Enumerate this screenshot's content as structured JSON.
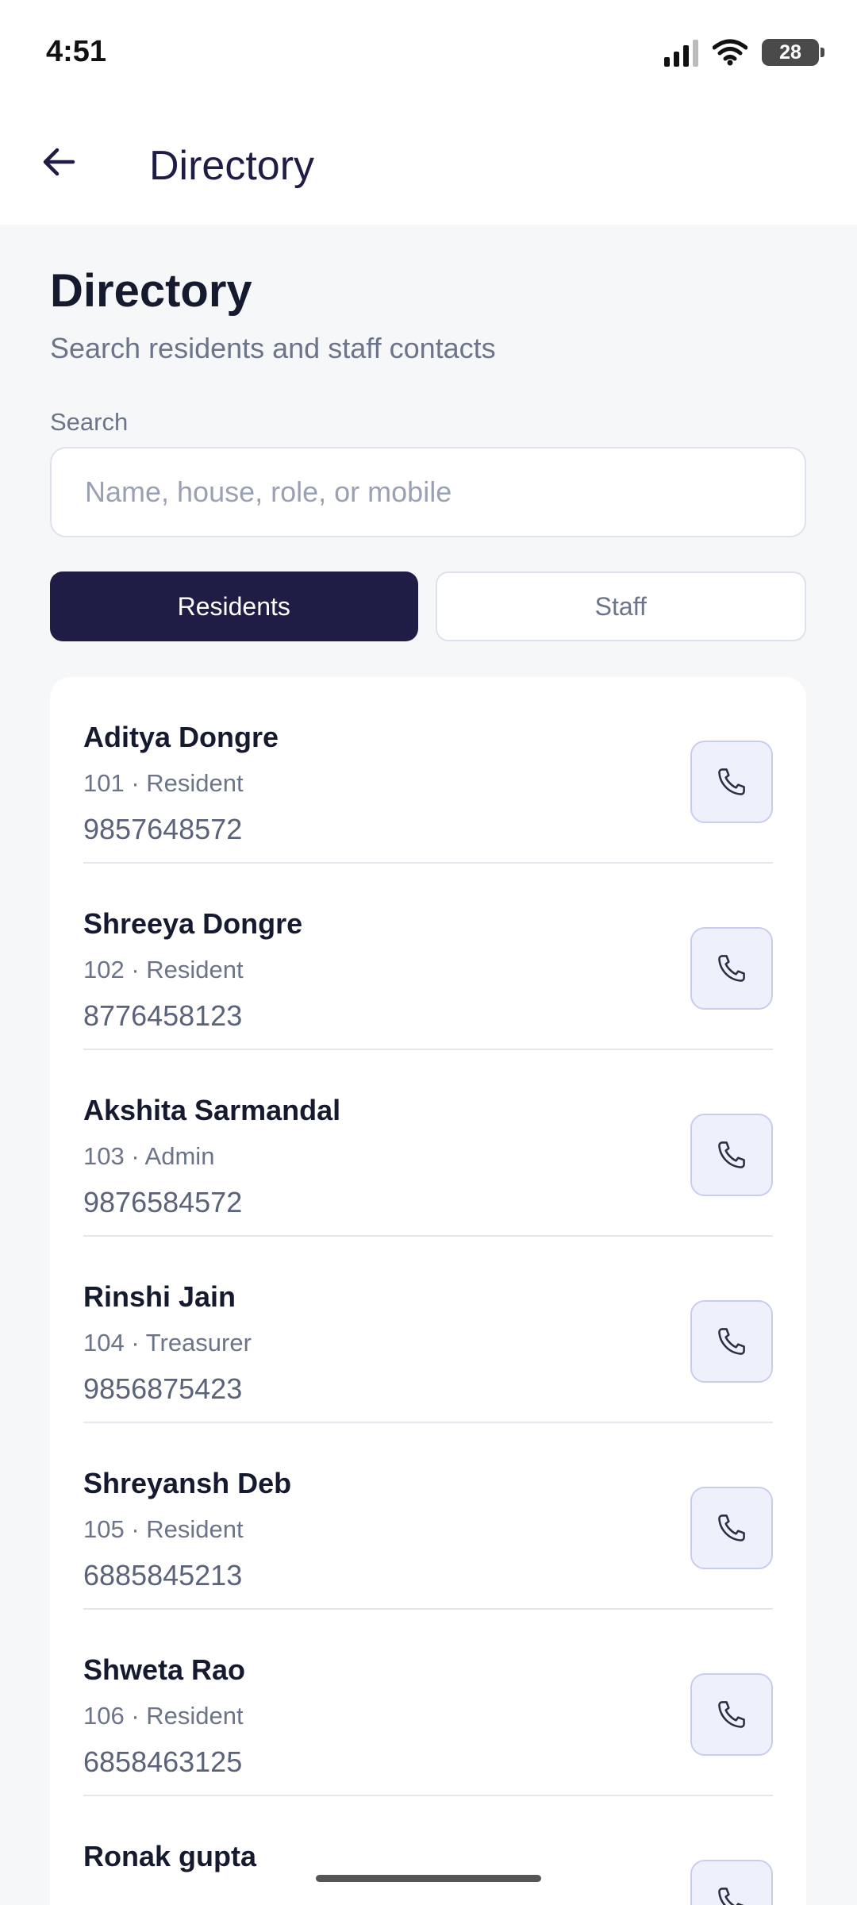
{
  "status_bar": {
    "time": "4:51",
    "battery": "28"
  },
  "app_bar": {
    "title": "Directory"
  },
  "header": {
    "title": "Directory",
    "subtitle": "Search residents and staff contacts"
  },
  "search": {
    "label": "Search",
    "placeholder": "Name, house, role, or mobile",
    "value": ""
  },
  "tabs": [
    {
      "label": "Residents",
      "active": true
    },
    {
      "label": "Staff",
      "active": false
    }
  ],
  "contacts": [
    {
      "name": "Aditya Dongre",
      "meta": "101 · Resident",
      "phone": "9857648572"
    },
    {
      "name": "Shreeya Dongre",
      "meta": "102 · Resident",
      "phone": "8776458123"
    },
    {
      "name": "Akshita Sarmandal",
      "meta": "103 · Admin",
      "phone": "9876584572"
    },
    {
      "name": "Rinshi Jain",
      "meta": "104 · Treasurer",
      "phone": "9856875423"
    },
    {
      "name": "Shreyansh Deb",
      "meta": "105 · Resident",
      "phone": "6885845213"
    },
    {
      "name": "Shweta Rao",
      "meta": "106 · Resident",
      "phone": "6858463125"
    },
    {
      "name": "Ronak gupta",
      "meta": "",
      "phone": ""
    }
  ],
  "colors": {
    "primary": "#1f1d45",
    "background": "#f6f7f9",
    "call_button_bg": "#eef0fc"
  },
  "icons": {
    "back": "arrow-left-icon",
    "call": "phone-icon"
  }
}
